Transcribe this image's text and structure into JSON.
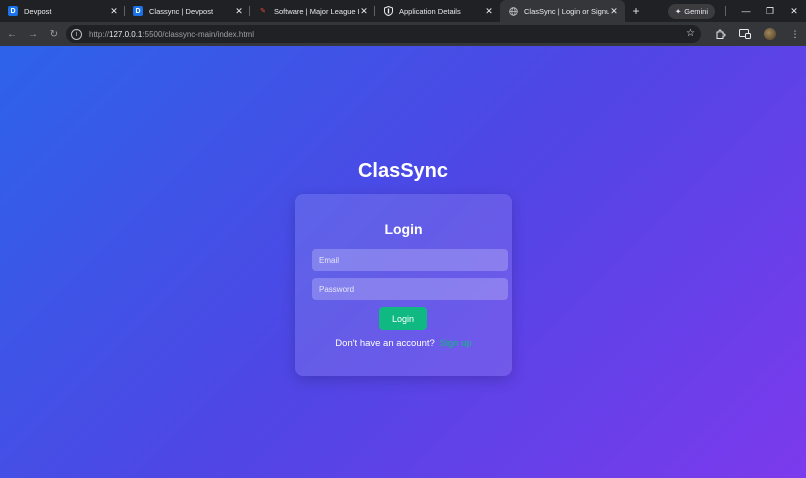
{
  "browser": {
    "tabs": [
      {
        "title": "Devpost",
        "favicon": "devpost-d-icon",
        "active": false
      },
      {
        "title": "Classync | Devpost",
        "favicon": "devpost-d-icon",
        "active": false
      },
      {
        "title": "Software | Major League Hack",
        "favicon": "mlh-icon",
        "active": false
      },
      {
        "title": "Application Details",
        "favicon": "shield-icon",
        "active": false
      },
      {
        "title": "ClasSync | Login or Signup",
        "favicon": "globe-icon",
        "active": true
      }
    ],
    "gemini_label": "Gemini",
    "url_prefix": "http://",
    "url_host": "127.0.0.1",
    "url_rest": ":5500/classync-main/index.html"
  },
  "page": {
    "app_title": "ClasSync",
    "card_title": "Login",
    "email_placeholder": "Email",
    "password_placeholder": "Password",
    "login_button": "Login",
    "signup_prompt": "Don't have an account?",
    "signup_link": "Sign up"
  },
  "colors": {
    "gradient_start": "#2d63ea",
    "gradient_end": "#7c3aed",
    "accent_green": "#10b981"
  }
}
